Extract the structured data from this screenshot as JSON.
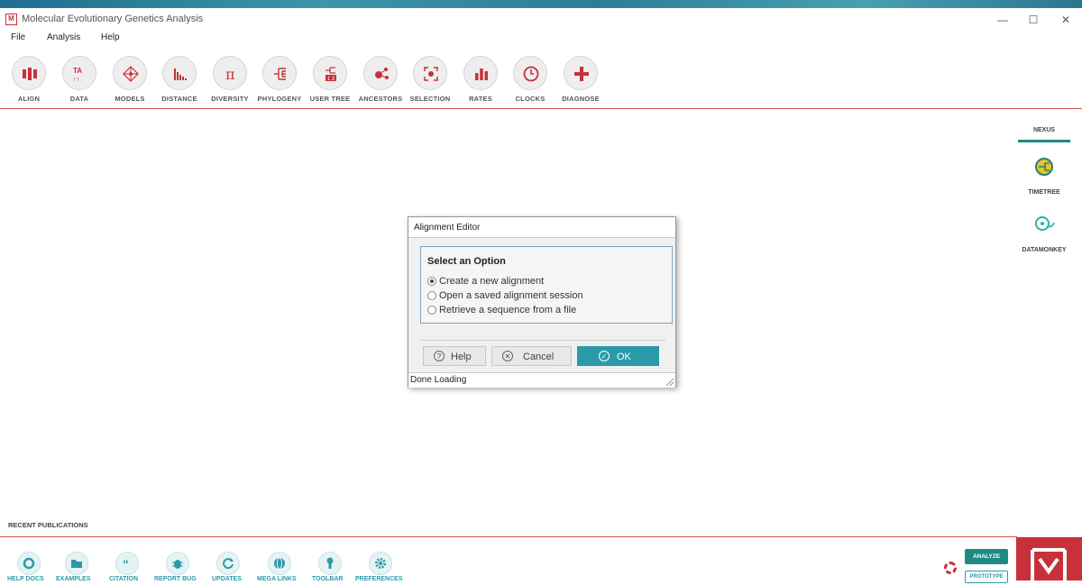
{
  "window": {
    "title": "Molecular Evolutionary Genetics Analysis",
    "controls": {
      "minimize": "—",
      "maximize": "☐",
      "close": "✕"
    }
  },
  "menu": [
    "File",
    "Analysis",
    "Help"
  ],
  "toolbar": [
    {
      "label": "ALIGN",
      "icon": "align-icon"
    },
    {
      "label": "DATA",
      "icon": "data-icon"
    },
    {
      "label": "MODELS",
      "icon": "models-icon"
    },
    {
      "label": "DISTANCE",
      "icon": "distance-icon"
    },
    {
      "label": "DIVERSITY",
      "icon": "pi-icon"
    },
    {
      "label": "PHYLOGENY",
      "icon": "phylogeny-icon"
    },
    {
      "label": "USER TREE",
      "icon": "user-tree-icon"
    },
    {
      "label": "ANCESTORS",
      "icon": "ancestors-icon"
    },
    {
      "label": "SELECTION",
      "icon": "selection-icon"
    },
    {
      "label": "RATES",
      "icon": "rates-icon"
    },
    {
      "label": "CLOCKS",
      "icon": "clock-icon"
    },
    {
      "label": "DIAGNOSE",
      "icon": "plus-icon"
    }
  ],
  "sidebar": {
    "nexus": "NEXUS",
    "timetree": "TIMETREE",
    "datamonkey": "DATAMONKEY"
  },
  "dialog": {
    "title": "Alignment Editor",
    "group_title": "Select an Option",
    "options": [
      {
        "label": "Create a new alignment",
        "checked": true
      },
      {
        "label": "Open a saved alignment session",
        "checked": false
      },
      {
        "label": "Retrieve a sequence from a file",
        "checked": false
      }
    ],
    "buttons": {
      "help": "Help",
      "cancel": "Cancel",
      "ok": "OK"
    },
    "status": "Done Loading"
  },
  "bottom": {
    "recent_label": "RECENT PUBLICATIONS",
    "links": [
      "HELP DOCS",
      "EXAMPLES",
      "CITATION",
      "REPORT BUG",
      "UPDATES",
      "MEGA LINKS",
      "TOOLBAR",
      "PREFERENCES"
    ],
    "analyze": "ANALYZE",
    "prototype": "PROTOTYPE"
  },
  "colors": {
    "accent_red": "#c8313a",
    "teal": "#2b9aa8"
  }
}
